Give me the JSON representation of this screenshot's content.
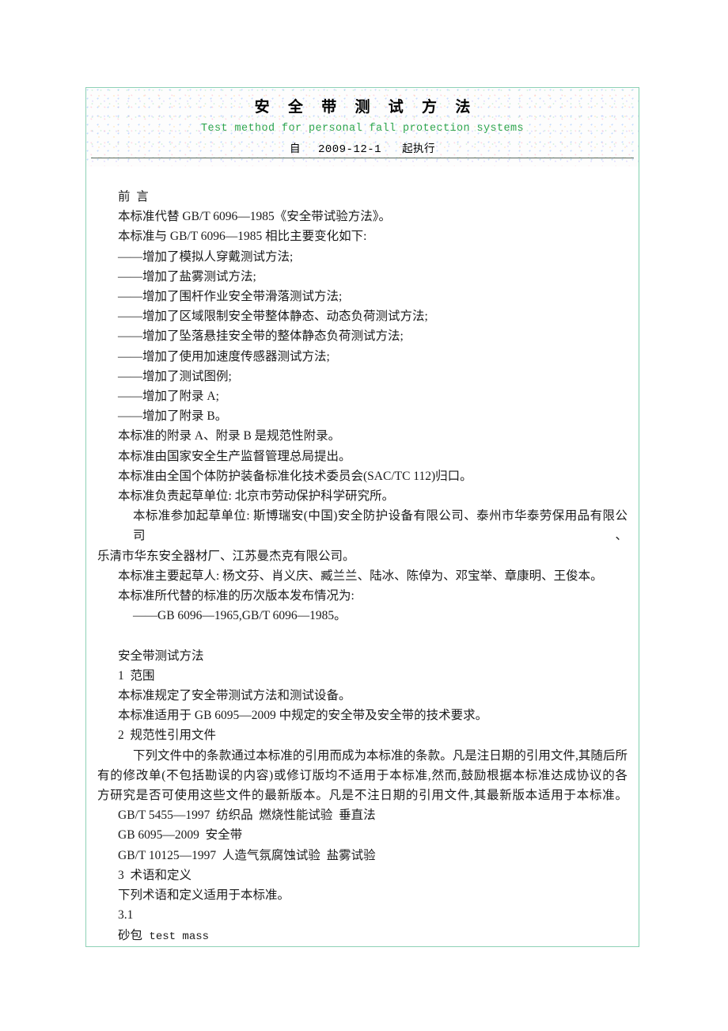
{
  "document": {
    "header": {
      "title_cn": "安 全 带 测 试 方 法",
      "title_en": "Test method for personal fall protection systems",
      "date_prefix": "自",
      "date": "2009-12-1",
      "date_suffix": "起执行",
      "accent_color": "#2fa64f",
      "border_color": "#8ed1b6",
      "rule_color": "#5d6b63"
    },
    "foreword": {
      "heading": "前  言",
      "lines": [
        "本标准代替 GB/T 6096—1985《安全带试验方法》。",
        "本标准与 GB/T 6096—1985 相比主要变化如下:",
        "——增加了模拟人穿戴测试方法;",
        "——增加了盐雾测试方法;",
        "——增加了围杆作业安全带滑落测试方法;",
        "——增加了区域限制安全带整体静态、动态负荷测试方法;",
        "——增加了坠落悬挂安全带的整体静态负荷测试方法;",
        "——增加了使用加速度传感器测试方法;",
        "——增加了测试图例;",
        "——增加了附录 A;",
        "——增加了附录 B。",
        "本标准的附录 A、附录 B 是规范性附录。",
        "本标准由国家安全生产监督管理总局提出。",
        "本标准由全国个体防护装备标准化技术委员会(SAC/TC 112)归口。",
        "本标准负责起草单位: 北京市劳动保护科学研究所。"
      ],
      "participants_line1": "本标准参加起草单位: 斯博瑞安(中国)安全防护设备有限公司、泰州市华泰劳保用品有限公司、",
      "participants_line2": "乐清市华东安全器材厂、江苏曼杰克有限公司。",
      "drafters": "本标准主要起草人: 杨文芬、肖义庆、臧兰兰、陆冰、陈倬为、邓宝举、章康明、王俊本。",
      "history_intro": "本标准所代替的标准的历次版本发布情况为:",
      "history_item": "——GB 6096—1965,GB/T 6096—1985。"
    },
    "main": {
      "doc_title": "安全带测试方法",
      "section1_heading": "1  范围",
      "section1_lines": [
        "本标准规定了安全带测试方法和测试设备。",
        "本标准适用于 GB 6095—2009 中规定的安全带及安全带的技术要求。"
      ],
      "section2_heading": "2  规范性引用文件",
      "section2_para_lines": [
        "下列文件中的条款通过本标准的引用而成为本标准的条款。凡是注日期的引用文件,其随后所",
        "有的修改单(不包括勘误的内容)或修订版均不适用于本标准,然而,鼓励根据本标准达成协议的各",
        "方研究是否可使用这些文件的最新版本。凡是不注日期的引用文件,其最新版本适用于本标准。"
      ],
      "references": [
        "GB/T 5455—1997  纺织品  燃烧性能试验  垂直法",
        "GB 6095—2009  安全带",
        "GB/T 10125—1997  人造气氛腐蚀试验  盐雾试验"
      ],
      "section3_heading": "3  术语和定义",
      "section3_line": "下列术语和定义适用于本标准。",
      "term_number": "3.1",
      "term_text": "砂包",
      "term_text_en": "test mass"
    }
  }
}
